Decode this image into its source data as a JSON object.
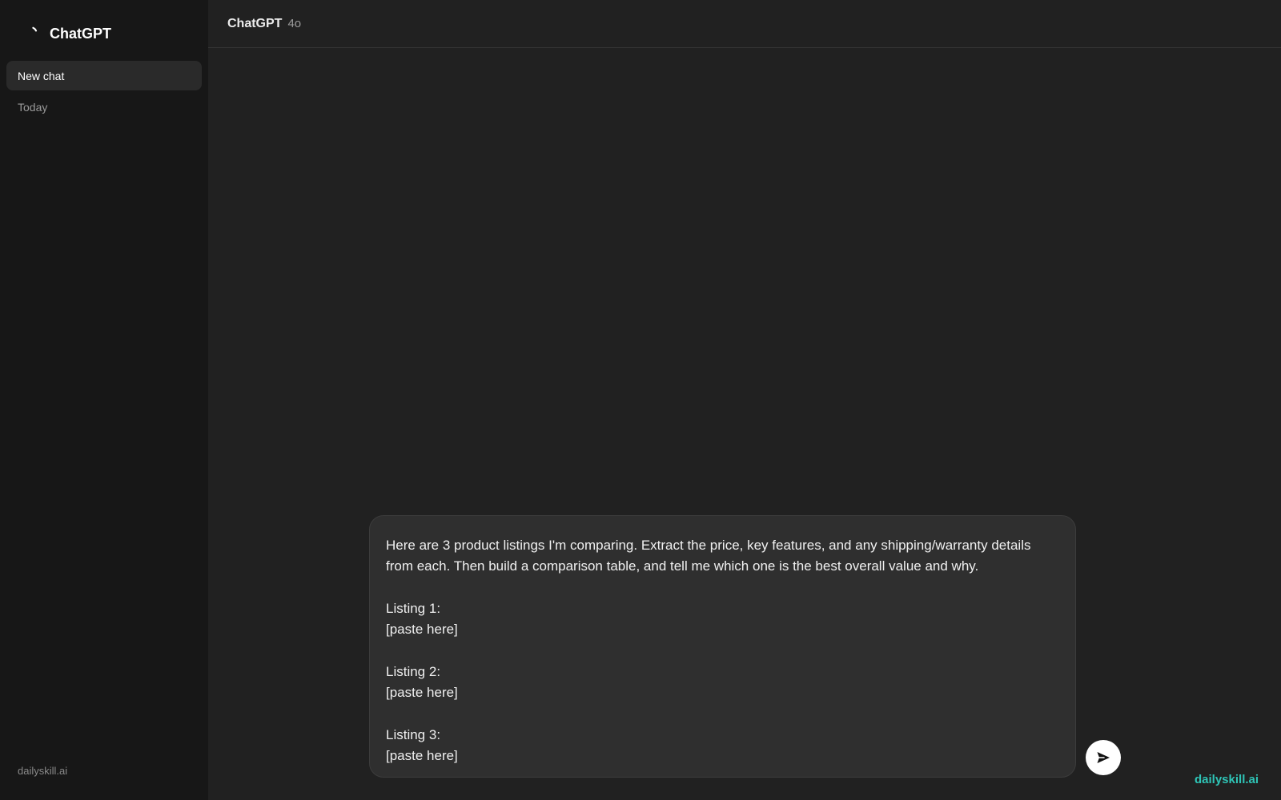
{
  "sidebar": {
    "brand": {
      "name": "ChatGPT",
      "logo_icon": "openai-logo-icon"
    },
    "new_chat_label": "New chat",
    "section_label": "Today",
    "footer_text": "dailyskill.ai"
  },
  "header": {
    "model_name": "ChatGPT",
    "model_version": "4o"
  },
  "composer": {
    "text": "Here are 3 product listings I'm comparing. Extract the price, key features, and any shipping/warranty details from each. Then build a comparison table, and tell me which one is the best overall value and why.\n\nListing 1:\n[paste here]\n\nListing 2:\n[paste here]\n\nListing 3:\n[paste here]",
    "send_icon": "send-arrow-icon"
  },
  "watermark": "dailyskill.ai",
  "colors": {
    "sidebar_bg": "#171717",
    "main_bg": "#212121",
    "composer_bg": "#2f2f2f",
    "accent": "#2ec4b6"
  }
}
